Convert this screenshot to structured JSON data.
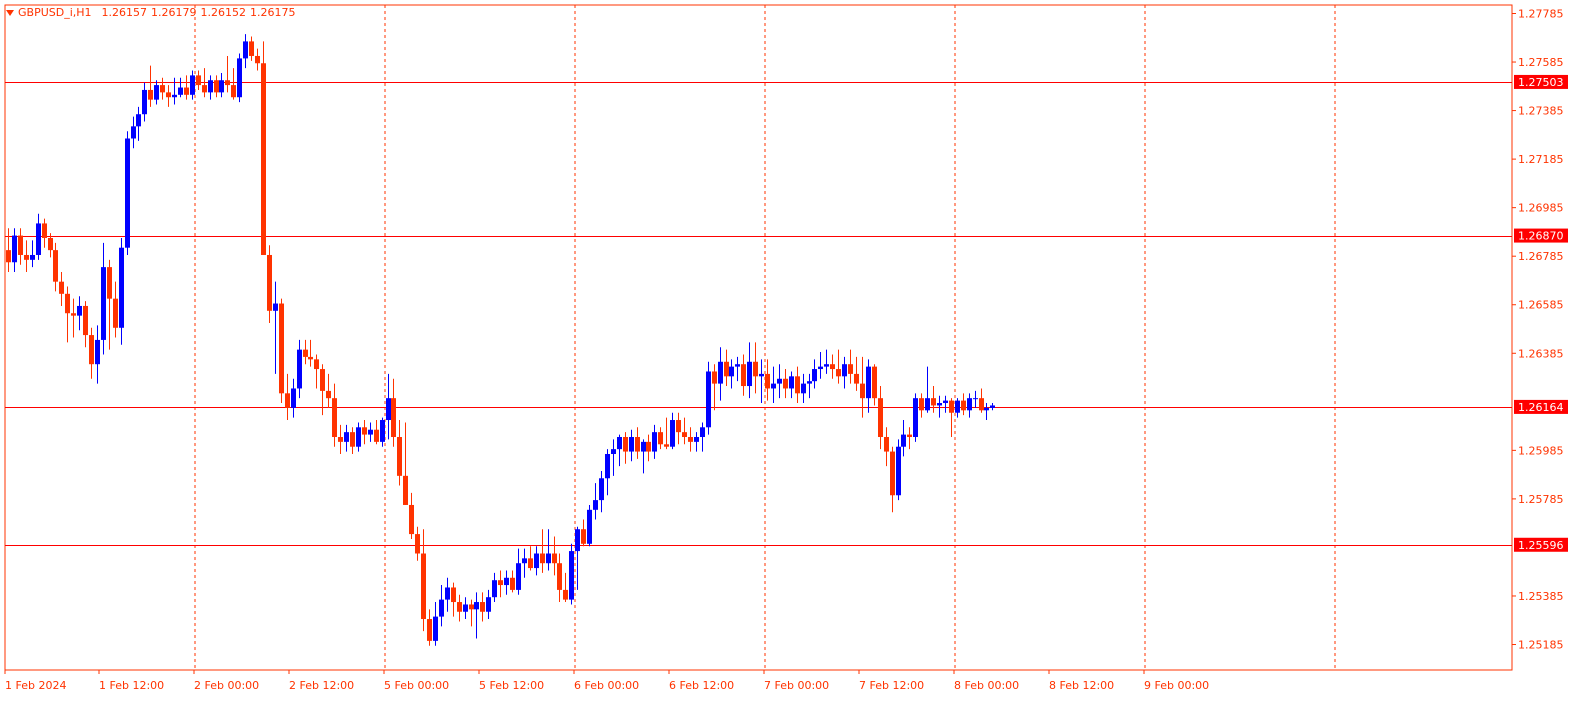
{
  "colors": {
    "background": "#ffffff",
    "grid": "#ff3300",
    "axis_text": "#ff3300",
    "bull": "#0000ff",
    "bear": "#ff3300",
    "hline": "#ff0000",
    "tag_bg": "#ff0000",
    "tag_text": "#ffffff"
  },
  "header": {
    "symbol": "GBPUSD_i,H1",
    "open": "1.26157",
    "high": "1.26179",
    "low": "1.26152",
    "close": "1.26175"
  },
  "chart_data": {
    "type": "candlestick",
    "timeframe": "H1",
    "ylim": [
      1.2508,
      1.2782
    ],
    "y_ticks": [
      "1.27785",
      "1.27585",
      "1.27385",
      "1.27185",
      "1.26985",
      "1.26785",
      "1.26585",
      "1.26385",
      "1.25985",
      "1.25785",
      "1.25385",
      "1.25185"
    ],
    "x_labels": [
      "1 Feb 2024",
      "1 Feb 12:00",
      "2 Feb 00:00",
      "2 Feb 12:00",
      "5 Feb 00:00",
      "5 Feb 12:00",
      "6 Feb 00:00",
      "6 Feb 12:00",
      "7 Feb 00:00",
      "7 Feb 12:00",
      "8 Feb 00:00",
      "8 Feb 12:00",
      "9 Feb 00:00"
    ],
    "horizontal_lines": [
      "1.27503",
      "1.26870",
      "1.26164",
      "1.25596"
    ],
    "grid": "vertical-dashed",
    "candles": [
      {
        "o": 1.2681,
        "h": 1.269,
        "l": 1.2672,
        "c": 1.2676
      },
      {
        "o": 1.2676,
        "h": 1.269,
        "l": 1.2672,
        "c": 1.2687
      },
      {
        "o": 1.2687,
        "h": 1.269,
        "l": 1.2675,
        "c": 1.2679
      },
      {
        "o": 1.2679,
        "h": 1.2685,
        "l": 1.2672,
        "c": 1.2677
      },
      {
        "o": 1.2677,
        "h": 1.2685,
        "l": 1.2674,
        "c": 1.2679
      },
      {
        "o": 1.2679,
        "h": 1.2696,
        "l": 1.2677,
        "c": 1.2692
      },
      {
        "o": 1.2692,
        "h": 1.2694,
        "l": 1.2682,
        "c": 1.2686
      },
      {
        "o": 1.2686,
        "h": 1.2688,
        "l": 1.2678,
        "c": 1.2681
      },
      {
        "o": 1.2681,
        "h": 1.2684,
        "l": 1.2664,
        "c": 1.2668
      },
      {
        "o": 1.2668,
        "h": 1.2672,
        "l": 1.2658,
        "c": 1.2663
      },
      {
        "o": 1.2663,
        "h": 1.2666,
        "l": 1.2643,
        "c": 1.2655
      },
      {
        "o": 1.2655,
        "h": 1.2661,
        "l": 1.2645,
        "c": 1.2654
      },
      {
        "o": 1.2654,
        "h": 1.2662,
        "l": 1.2648,
        "c": 1.2658
      },
      {
        "o": 1.2658,
        "h": 1.266,
        "l": 1.2641,
        "c": 1.2646
      },
      {
        "o": 1.2646,
        "h": 1.2649,
        "l": 1.2628,
        "c": 1.2634
      },
      {
        "o": 1.2634,
        "h": 1.265,
        "l": 1.2626,
        "c": 1.2644
      },
      {
        "o": 1.2644,
        "h": 1.2684,
        "l": 1.2638,
        "c": 1.2674
      },
      {
        "o": 1.2674,
        "h": 1.2677,
        "l": 1.264,
        "c": 1.2661
      },
      {
        "o": 1.2661,
        "h": 1.2668,
        "l": 1.2645,
        "c": 1.2649
      },
      {
        "o": 1.2649,
        "h": 1.2686,
        "l": 1.2642,
        "c": 1.2682
      },
      {
        "o": 1.2682,
        "h": 1.273,
        "l": 1.2679,
        "c": 1.2727
      },
      {
        "o": 1.2727,
        "h": 1.2736,
        "l": 1.2723,
        "c": 1.2732
      },
      {
        "o": 1.2732,
        "h": 1.274,
        "l": 1.2726,
        "c": 1.2737
      },
      {
        "o": 1.2737,
        "h": 1.275,
        "l": 1.2734,
        "c": 1.2747
      },
      {
        "o": 1.2747,
        "h": 1.2757,
        "l": 1.274,
        "c": 1.2743
      },
      {
        "o": 1.2743,
        "h": 1.2751,
        "l": 1.2741,
        "c": 1.2749
      },
      {
        "o": 1.2749,
        "h": 1.2752,
        "l": 1.2743,
        "c": 1.2746
      },
      {
        "o": 1.2746,
        "h": 1.2749,
        "l": 1.274,
        "c": 1.2744
      },
      {
        "o": 1.2744,
        "h": 1.2752,
        "l": 1.2741,
        "c": 1.2745
      },
      {
        "o": 1.2745,
        "h": 1.2752,
        "l": 1.2744,
        "c": 1.2748
      },
      {
        "o": 1.2748,
        "h": 1.2753,
        "l": 1.2743,
        "c": 1.2745
      },
      {
        "o": 1.2745,
        "h": 1.2755,
        "l": 1.2743,
        "c": 1.2753
      },
      {
        "o": 1.2753,
        "h": 1.2755,
        "l": 1.2747,
        "c": 1.2749
      },
      {
        "o": 1.2749,
        "h": 1.2756,
        "l": 1.2744,
        "c": 1.2746
      },
      {
        "o": 1.2746,
        "h": 1.2753,
        "l": 1.2743,
        "c": 1.2751
      },
      {
        "o": 1.2751,
        "h": 1.2753,
        "l": 1.2744,
        "c": 1.2746
      },
      {
        "o": 1.2746,
        "h": 1.2754,
        "l": 1.2744,
        "c": 1.2751
      },
      {
        "o": 1.2751,
        "h": 1.2761,
        "l": 1.2746,
        "c": 1.2749
      },
      {
        "o": 1.2749,
        "h": 1.2756,
        "l": 1.2743,
        "c": 1.2744
      },
      {
        "o": 1.2744,
        "h": 1.2762,
        "l": 1.2742,
        "c": 1.276
      },
      {
        "o": 1.276,
        "h": 1.277,
        "l": 1.2756,
        "c": 1.2767
      },
      {
        "o": 1.2767,
        "h": 1.2769,
        "l": 1.2759,
        "c": 1.2761
      },
      {
        "o": 1.2761,
        "h": 1.2764,
        "l": 1.2755,
        "c": 1.2758
      },
      {
        "o": 1.2758,
        "h": 1.2767,
        "l": 1.269,
        "c": 1.2679
      },
      {
        "o": 1.2679,
        "h": 1.2683,
        "l": 1.2651,
        "c": 1.2656
      },
      {
        "o": 1.2656,
        "h": 1.2668,
        "l": 1.263,
        "c": 1.2659
      },
      {
        "o": 1.2659,
        "h": 1.2661,
        "l": 1.2618,
        "c": 1.2622
      },
      {
        "o": 1.2622,
        "h": 1.263,
        "l": 1.2611,
        "c": 1.2616
      },
      {
        "o": 1.2616,
        "h": 1.2628,
        "l": 1.2612,
        "c": 1.2624
      },
      {
        "o": 1.2624,
        "h": 1.2644,
        "l": 1.262,
        "c": 1.264
      },
      {
        "o": 1.264,
        "h": 1.2644,
        "l": 1.2634,
        "c": 1.2637
      },
      {
        "o": 1.2637,
        "h": 1.2644,
        "l": 1.2633,
        "c": 1.2636
      },
      {
        "o": 1.2636,
        "h": 1.2638,
        "l": 1.2624,
        "c": 1.2632
      },
      {
        "o": 1.2632,
        "h": 1.2634,
        "l": 1.2613,
        "c": 1.2623
      },
      {
        "o": 1.2623,
        "h": 1.263,
        "l": 1.2616,
        "c": 1.262
      },
      {
        "o": 1.262,
        "h": 1.2626,
        "l": 1.26,
        "c": 1.2604
      },
      {
        "o": 1.2604,
        "h": 1.2609,
        "l": 1.2597,
        "c": 1.2602
      },
      {
        "o": 1.2602,
        "h": 1.2609,
        "l": 1.2598,
        "c": 1.2606
      },
      {
        "o": 1.2606,
        "h": 1.2608,
        "l": 1.2597,
        "c": 1.26
      },
      {
        "o": 1.26,
        "h": 1.261,
        "l": 1.2598,
        "c": 1.2608
      },
      {
        "o": 1.2608,
        "h": 1.2611,
        "l": 1.2601,
        "c": 1.2605
      },
      {
        "o": 1.2605,
        "h": 1.261,
        "l": 1.2602,
        "c": 1.2607
      },
      {
        "o": 1.2607,
        "h": 1.2611,
        "l": 1.2601,
        "c": 1.2602
      },
      {
        "o": 1.2602,
        "h": 1.2612,
        "l": 1.26,
        "c": 1.2611
      },
      {
        "o": 1.2611,
        "h": 1.263,
        "l": 1.2603,
        "c": 1.262
      },
      {
        "o": 1.262,
        "h": 1.2628,
        "l": 1.26,
        "c": 1.2604
      },
      {
        "o": 1.2604,
        "h": 1.2611,
        "l": 1.2584,
        "c": 1.2588
      },
      {
        "o": 1.2588,
        "h": 1.261,
        "l": 1.2576,
        "c": 1.2576
      },
      {
        "o": 1.2576,
        "h": 1.2581,
        "l": 1.2562,
        "c": 1.2564
      },
      {
        "o": 1.2564,
        "h": 1.2567,
        "l": 1.2553,
        "c": 1.2556
      },
      {
        "o": 1.2556,
        "h": 1.2566,
        "l": 1.2524,
        "c": 1.2529
      },
      {
        "o": 1.2529,
        "h": 1.2533,
        "l": 1.2518,
        "c": 1.252
      },
      {
        "o": 1.252,
        "h": 1.2536,
        "l": 1.2518,
        "c": 1.253
      },
      {
        "o": 1.253,
        "h": 1.2543,
        "l": 1.2526,
        "c": 1.2537
      },
      {
        "o": 1.2537,
        "h": 1.2546,
        "l": 1.2532,
        "c": 1.2542
      },
      {
        "o": 1.2542,
        "h": 1.2544,
        "l": 1.253,
        "c": 1.2536
      },
      {
        "o": 1.2536,
        "h": 1.2539,
        "l": 1.2528,
        "c": 1.2532
      },
      {
        "o": 1.2532,
        "h": 1.2538,
        "l": 1.2529,
        "c": 1.2535
      },
      {
        "o": 1.2535,
        "h": 1.2537,
        "l": 1.2526,
        "c": 1.2533
      },
      {
        "o": 1.2533,
        "h": 1.254,
        "l": 1.2521,
        "c": 1.2536
      },
      {
        "o": 1.2536,
        "h": 1.254,
        "l": 1.2528,
        "c": 1.2532
      },
      {
        "o": 1.2532,
        "h": 1.2541,
        "l": 1.2529,
        "c": 1.2538
      },
      {
        "o": 1.2538,
        "h": 1.2548,
        "l": 1.2536,
        "c": 1.2545
      },
      {
        "o": 1.2545,
        "h": 1.2549,
        "l": 1.2538,
        "c": 1.2543
      },
      {
        "o": 1.2543,
        "h": 1.2549,
        "l": 1.2539,
        "c": 1.2546
      },
      {
        "o": 1.2546,
        "h": 1.2549,
        "l": 1.254,
        "c": 1.2541
      },
      {
        "o": 1.2541,
        "h": 1.2558,
        "l": 1.2539,
        "c": 1.2552
      },
      {
        "o": 1.2552,
        "h": 1.2558,
        "l": 1.2546,
        "c": 1.2554
      },
      {
        "o": 1.2554,
        "h": 1.2559,
        "l": 1.2549,
        "c": 1.255
      },
      {
        "o": 1.255,
        "h": 1.2559,
        "l": 1.2547,
        "c": 1.2556
      },
      {
        "o": 1.2556,
        "h": 1.2566,
        "l": 1.2548,
        "c": 1.2552
      },
      {
        "o": 1.2552,
        "h": 1.2566,
        "l": 1.2549,
        "c": 1.2556
      },
      {
        "o": 1.2556,
        "h": 1.2563,
        "l": 1.2547,
        "c": 1.2552
      },
      {
        "o": 1.2552,
        "h": 1.2556,
        "l": 1.2536,
        "c": 1.2541
      },
      {
        "o": 1.2541,
        "h": 1.2548,
        "l": 1.2536,
        "c": 1.2537
      },
      {
        "o": 1.2537,
        "h": 1.256,
        "l": 1.2535,
        "c": 1.2557
      },
      {
        "o": 1.2557,
        "h": 1.2567,
        "l": 1.2541,
        "c": 1.2566
      },
      {
        "o": 1.2566,
        "h": 1.257,
        "l": 1.2559,
        "c": 1.256
      },
      {
        "o": 1.256,
        "h": 1.2576,
        "l": 1.2559,
        "c": 1.2574
      },
      {
        "o": 1.2574,
        "h": 1.2585,
        "l": 1.257,
        "c": 1.2578
      },
      {
        "o": 1.2578,
        "h": 1.259,
        "l": 1.2573,
        "c": 1.2587
      },
      {
        "o": 1.2587,
        "h": 1.2599,
        "l": 1.258,
        "c": 1.2597
      },
      {
        "o": 1.2597,
        "h": 1.2603,
        "l": 1.2588,
        "c": 1.2599
      },
      {
        "o": 1.2599,
        "h": 1.2605,
        "l": 1.2592,
        "c": 1.2604
      },
      {
        "o": 1.2604,
        "h": 1.2606,
        "l": 1.2593,
        "c": 1.2598
      },
      {
        "o": 1.2598,
        "h": 1.2607,
        "l": 1.2594,
        "c": 1.2604
      },
      {
        "o": 1.2604,
        "h": 1.2608,
        "l": 1.2595,
        "c": 1.2598
      },
      {
        "o": 1.2598,
        "h": 1.2603,
        "l": 1.2589,
        "c": 1.2602
      },
      {
        "o": 1.2602,
        "h": 1.2605,
        "l": 1.2594,
        "c": 1.2598
      },
      {
        "o": 1.2598,
        "h": 1.2609,
        "l": 1.2595,
        "c": 1.2606
      },
      {
        "o": 1.2606,
        "h": 1.2608,
        "l": 1.2599,
        "c": 1.2601
      },
      {
        "o": 1.2601,
        "h": 1.2612,
        "l": 1.2599,
        "c": 1.26
      },
      {
        "o": 1.26,
        "h": 1.2614,
        "l": 1.2599,
        "c": 1.2611
      },
      {
        "o": 1.2611,
        "h": 1.2614,
        "l": 1.2601,
        "c": 1.2606
      },
      {
        "o": 1.2606,
        "h": 1.2612,
        "l": 1.2601,
        "c": 1.2604
      },
      {
        "o": 1.2604,
        "h": 1.2608,
        "l": 1.2598,
        "c": 1.2602
      },
      {
        "o": 1.2602,
        "h": 1.2606,
        "l": 1.2598,
        "c": 1.2604
      },
      {
        "o": 1.2604,
        "h": 1.261,
        "l": 1.2598,
        "c": 1.2608
      },
      {
        "o": 1.2608,
        "h": 1.2635,
        "l": 1.2605,
        "c": 1.2631
      },
      {
        "o": 1.2631,
        "h": 1.2634,
        "l": 1.2615,
        "c": 1.2626
      },
      {
        "o": 1.2626,
        "h": 1.2641,
        "l": 1.2619,
        "c": 1.2635
      },
      {
        "o": 1.2635,
        "h": 1.264,
        "l": 1.2625,
        "c": 1.2629
      },
      {
        "o": 1.2629,
        "h": 1.2636,
        "l": 1.2624,
        "c": 1.2633
      },
      {
        "o": 1.2633,
        "h": 1.2637,
        "l": 1.2627,
        "c": 1.2634
      },
      {
        "o": 1.2634,
        "h": 1.2638,
        "l": 1.2621,
        "c": 1.2625
      },
      {
        "o": 1.2625,
        "h": 1.2643,
        "l": 1.262,
        "c": 1.2635
      },
      {
        "o": 1.2635,
        "h": 1.2643,
        "l": 1.2622,
        "c": 1.2629
      },
      {
        "o": 1.2629,
        "h": 1.2636,
        "l": 1.2618,
        "c": 1.263
      },
      {
        "o": 1.263,
        "h": 1.2636,
        "l": 1.2619,
        "c": 1.2624
      },
      {
        "o": 1.2624,
        "h": 1.2633,
        "l": 1.2618,
        "c": 1.2626
      },
      {
        "o": 1.2626,
        "h": 1.2634,
        "l": 1.262,
        "c": 1.2628
      },
      {
        "o": 1.2628,
        "h": 1.2632,
        "l": 1.262,
        "c": 1.2624
      },
      {
        "o": 1.2624,
        "h": 1.2631,
        "l": 1.262,
        "c": 1.2629
      },
      {
        "o": 1.2629,
        "h": 1.2633,
        "l": 1.2618,
        "c": 1.2622
      },
      {
        "o": 1.2622,
        "h": 1.263,
        "l": 1.2618,
        "c": 1.2626
      },
      {
        "o": 1.2626,
        "h": 1.263,
        "l": 1.262,
        "c": 1.2627
      },
      {
        "o": 1.2627,
        "h": 1.2636,
        "l": 1.2624,
        "c": 1.2632
      },
      {
        "o": 1.2632,
        "h": 1.2639,
        "l": 1.2628,
        "c": 1.2633
      },
      {
        "o": 1.2633,
        "h": 1.264,
        "l": 1.263,
        "c": 1.2634
      },
      {
        "o": 1.2634,
        "h": 1.2638,
        "l": 1.2628,
        "c": 1.2632
      },
      {
        "o": 1.2632,
        "h": 1.264,
        "l": 1.2626,
        "c": 1.2629
      },
      {
        "o": 1.2629,
        "h": 1.2637,
        "l": 1.2624,
        "c": 1.2634
      },
      {
        "o": 1.2634,
        "h": 1.264,
        "l": 1.2626,
        "c": 1.263
      },
      {
        "o": 1.263,
        "h": 1.2637,
        "l": 1.2623,
        "c": 1.2626
      },
      {
        "o": 1.2626,
        "h": 1.2637,
        "l": 1.2612,
        "c": 1.262
      },
      {
        "o": 1.262,
        "h": 1.2636,
        "l": 1.2614,
        "c": 1.2633
      },
      {
        "o": 1.2633,
        "h": 1.2634,
        "l": 1.2617,
        "c": 1.262
      },
      {
        "o": 1.262,
        "h": 1.2625,
        "l": 1.2599,
        "c": 1.2604
      },
      {
        "o": 1.2604,
        "h": 1.2608,
        "l": 1.2592,
        "c": 1.2598
      },
      {
        "o": 1.2598,
        "h": 1.26,
        "l": 1.2573,
        "c": 1.258
      },
      {
        "o": 1.258,
        "h": 1.2603,
        "l": 1.2578,
        "c": 1.26
      },
      {
        "o": 1.26,
        "h": 1.2611,
        "l": 1.2596,
        "c": 1.2605
      },
      {
        "o": 1.2605,
        "h": 1.2608,
        "l": 1.2599,
        "c": 1.2604
      },
      {
        "o": 1.2604,
        "h": 1.2622,
        "l": 1.2602,
        "c": 1.262
      },
      {
        "o": 1.262,
        "h": 1.2622,
        "l": 1.2612,
        "c": 1.2615
      },
      {
        "o": 1.2615,
        "h": 1.2633,
        "l": 1.2614,
        "c": 1.262
      },
      {
        "o": 1.262,
        "h": 1.2625,
        "l": 1.2614,
        "c": 1.2617
      },
      {
        "o": 1.2617,
        "h": 1.2621,
        "l": 1.2612,
        "c": 1.2618
      },
      {
        "o": 1.2618,
        "h": 1.2621,
        "l": 1.2614,
        "c": 1.2619
      },
      {
        "o": 1.2619,
        "h": 1.262,
        "l": 1.2604,
        "c": 1.2614
      },
      {
        "o": 1.2614,
        "h": 1.262,
        "l": 1.2612,
        "c": 1.2619
      },
      {
        "o": 1.2619,
        "h": 1.2622,
        "l": 1.2613,
        "c": 1.2615
      },
      {
        "o": 1.2615,
        "h": 1.2622,
        "l": 1.2612,
        "c": 1.262
      },
      {
        "o": 1.262,
        "h": 1.2623,
        "l": 1.2616,
        "c": 1.262
      },
      {
        "o": 1.262,
        "h": 1.2624,
        "l": 1.2614,
        "c": 1.2615
      },
      {
        "o": 1.2615,
        "h": 1.2618,
        "l": 1.2611,
        "c": 1.2616
      },
      {
        "o": 1.2616,
        "h": 1.2618,
        "l": 1.2615,
        "c": 1.2617
      }
    ]
  }
}
